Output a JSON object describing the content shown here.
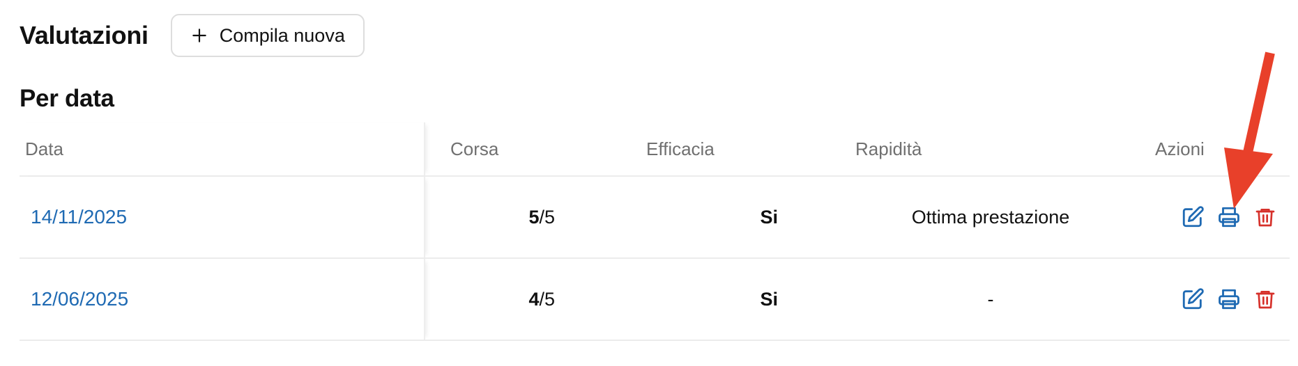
{
  "header": {
    "title": "Valutazioni",
    "new_button_label": "Compila nuova"
  },
  "section": {
    "title": "Per data"
  },
  "table": {
    "columns": [
      "Data",
      "Corsa",
      "Efficacia",
      "Rapidità",
      "Azioni"
    ],
    "rows": [
      {
        "date": "14/11/2025",
        "corsa_score": "5",
        "corsa_max": "/5",
        "efficacia": "Si",
        "rapidita": "Ottima prestazione"
      },
      {
        "date": "12/06/2025",
        "corsa_score": "4",
        "corsa_max": "/5",
        "efficacia": "Si",
        "rapidita": "-"
      }
    ]
  },
  "icons": {
    "add": "plus-icon",
    "edit": "edit-icon",
    "print": "printer-icon",
    "delete": "trash-icon",
    "annotation": "red-arrow"
  },
  "colors": {
    "link": "#1f6ab3",
    "action_blue": "#1f6ab3",
    "delete_red": "#d6312b",
    "arrow_red": "#e8402a"
  }
}
